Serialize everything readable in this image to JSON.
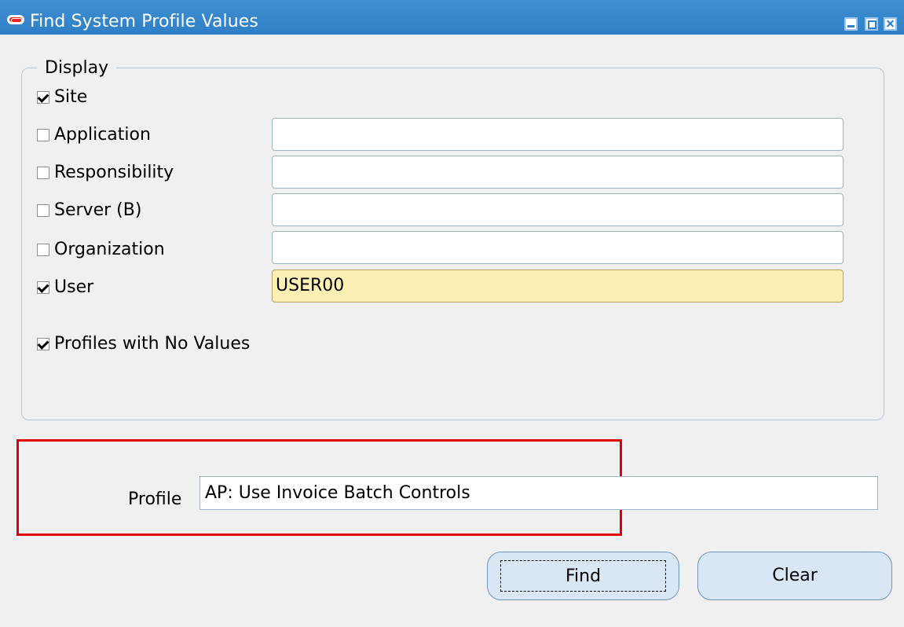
{
  "window": {
    "title": "Find System Profile Values"
  },
  "display": {
    "title": "Display",
    "rows": [
      {
        "label": "Site",
        "checked": true,
        "value": ""
      },
      {
        "label": "Application",
        "checked": false,
        "value": ""
      },
      {
        "label": "Responsibility",
        "checked": false,
        "value": ""
      },
      {
        "label": "Server (B)",
        "checked": false,
        "value": ""
      },
      {
        "label": "Organization",
        "checked": false,
        "value": ""
      },
      {
        "label": "User",
        "checked": true,
        "value": "USER00"
      }
    ],
    "profiles_no_values": {
      "label": "Profiles with No Values",
      "checked": true
    }
  },
  "profile": {
    "label": "Profile",
    "value": "AP: Use Invoice Batch Controls"
  },
  "buttons": {
    "find": "Find",
    "clear": "Clear"
  },
  "colors": {
    "titlebar": "#2f7fc6",
    "highlight_box": "#e10000",
    "highlight_field": "#fcefb4"
  }
}
